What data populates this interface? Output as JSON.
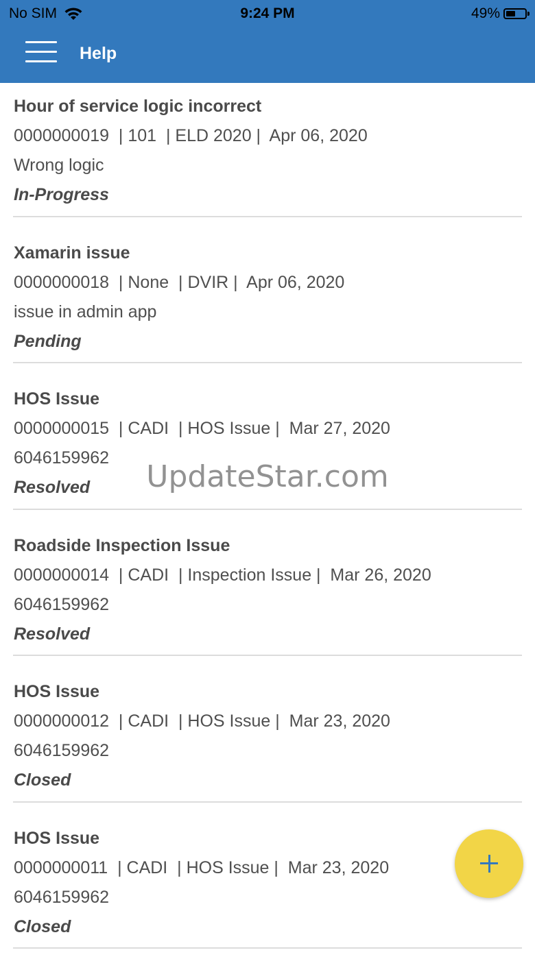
{
  "status_bar": {
    "carrier": "No SIM",
    "time": "9:24 PM",
    "battery": "49%",
    "battery_level": 0.49,
    "icons": [
      "wifi-icon",
      "battery-icon"
    ]
  },
  "nav": {
    "title": "Help",
    "menu_icon": "hamburger-menu-icon",
    "background_color": "#3379bd"
  },
  "tickets": [
    {
      "title": "Hour of service logic incorrect",
      "meta": "0000000019  | 101  | ELD 2020 |  Apr 06, 2020",
      "description": "Wrong logic",
      "status": "In-Progress"
    },
    {
      "title": "Xamarin issue",
      "meta": "0000000018  | None  | DVIR |  Apr 06, 2020",
      "description": "issue in admin app",
      "status": "Pending"
    },
    {
      "title": "HOS Issue",
      "meta": "0000000015  | CADI  | HOS Issue |  Mar 27, 2020",
      "description": "6046159962",
      "status": "Resolved"
    },
    {
      "title": "Roadside Inspection Issue",
      "meta": "0000000014  | CADI  | Inspection Issue |  Mar 26, 2020",
      "description": "6046159962",
      "status": "Resolved"
    },
    {
      "title": "HOS Issue",
      "meta": "0000000012  | CADI  | HOS Issue |  Mar 23, 2020",
      "description": "6046159962",
      "status": "Closed"
    },
    {
      "title": "HOS Issue",
      "meta": "0000000011  | CADI  | HOS Issue |  Mar 23, 2020",
      "description": "6046159962",
      "status": "Closed"
    }
  ],
  "watermark": "UpdateStar.com",
  "fab": {
    "icon": "plus-icon",
    "color": "#f2d547"
  }
}
